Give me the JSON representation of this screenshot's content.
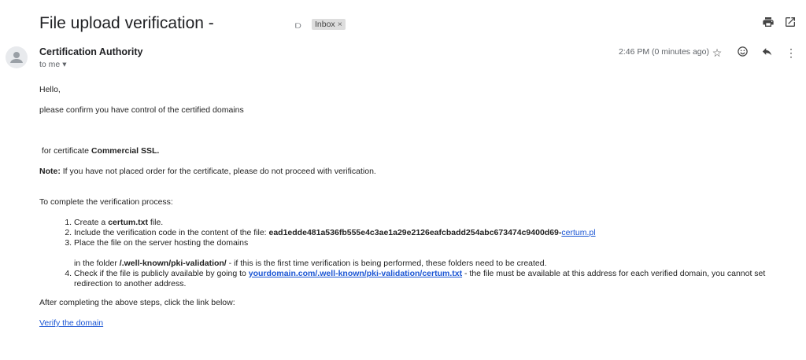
{
  "header": {
    "subject": "File upload verification -",
    "importance_icon": "importance-marker-icon",
    "label": "Inbox",
    "label_close": "×",
    "print_icon": "print-icon",
    "open_new_window_icon": "open-in-new-window-icon"
  },
  "message": {
    "sender": "Certification Authority",
    "to": "to me",
    "time": "2:46 PM (0 minutes ago)",
    "actions": [
      "star-icon",
      "emoji-icon",
      "reply-icon",
      "more-options-icon"
    ]
  },
  "body": {
    "greeting": "Hello,",
    "line1": "please confirm you have control of the certified domains",
    "cert_prefix": " for certificate ",
    "cert_name": "Commercial SSL.",
    "note_label": "Note:",
    "note_text": " If you have not placed order for the certificate, please do not proceed with verification.",
    "steps_intro": "To complete the verification process:",
    "step1_a": "Create a ",
    "step1_b": "certum.txt",
    "step1_c": " file.",
    "step2_a": "Include the verification code in the content of the file: ",
    "step2_code": "ead1edde481a536fb555e4c3ae1a29e2126eafcbadd254abc673474c9400d69-",
    "step2_link": "certum.pl",
    "step3": "Place the file on the server hosting the domains",
    "folder_a": "in the folder ",
    "folder_b": "/.well-known/pki-validation/",
    "folder_c": " - if this is the first time verification is being performed, these folders need to be created.",
    "step4_a": "Check if the file is publicly available by going to ",
    "step4_link": "yourdomain.com/.well-known/pki-validation/certum.txt",
    "step4_b": " - the file must be available at this address for each verified domain, you cannot set redirection to another address.",
    "after": "After completing the above steps, click the link below:",
    "verify_link": "Verify the domain"
  }
}
